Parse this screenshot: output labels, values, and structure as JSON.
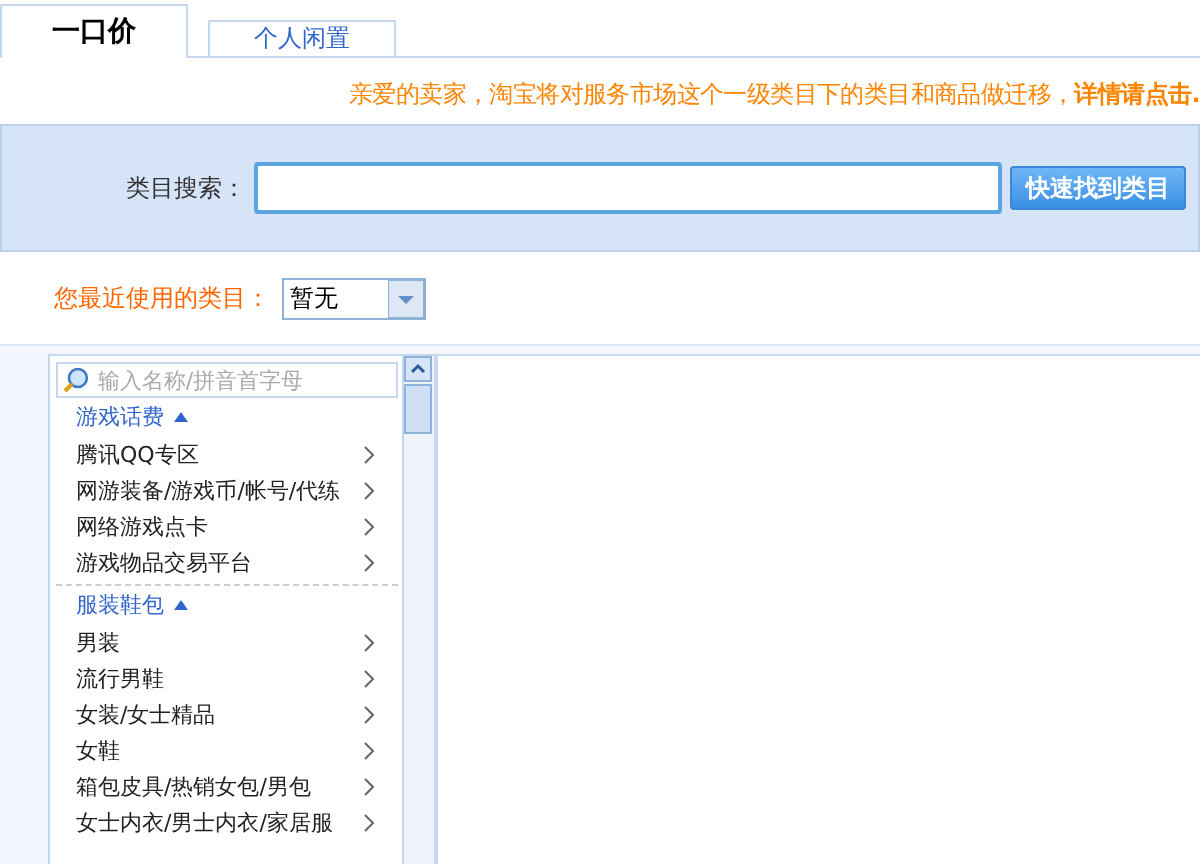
{
  "tabs": [
    {
      "label": "一口价",
      "selected": true
    },
    {
      "label": "个人闲置",
      "selected": false
    }
  ],
  "notice": "亲爱的卖家，淘宝将对服务市场这个一级类目下的类目和商品做迁移，**详情请点击.**",
  "search": {
    "label": "类目搜索：",
    "button": "快速找到类目"
  },
  "recent": {
    "label": "您最近使用的类目：",
    "value": "暂无"
  },
  "category_list": {
    "placeholder": "输入名称/拼音首字母",
    "groups": [
      {
        "title": "游戏话费",
        "expanded": true,
        "children": [
          {
            "label": "腾讯QQ专区"
          },
          {
            "label": "网游装备/游戏币/帐号/代练"
          },
          {
            "label": "网络游戏点卡"
          },
          {
            "label": "游戏物品交易平台"
          }
        ]
      },
      {
        "title": "服装鞋包",
        "expanded": true,
        "children": [
          {
            "label": "男装"
          },
          {
            "label": "流行男鞋"
          },
          {
            "label": "女装/女士精品"
          },
          {
            "label": "女鞋"
          },
          {
            "label": "箱包皮具/热销女包/男包"
          },
          {
            "label": "女士内衣/男士内衣/家居服"
          }
        ]
      }
    ]
  }
}
